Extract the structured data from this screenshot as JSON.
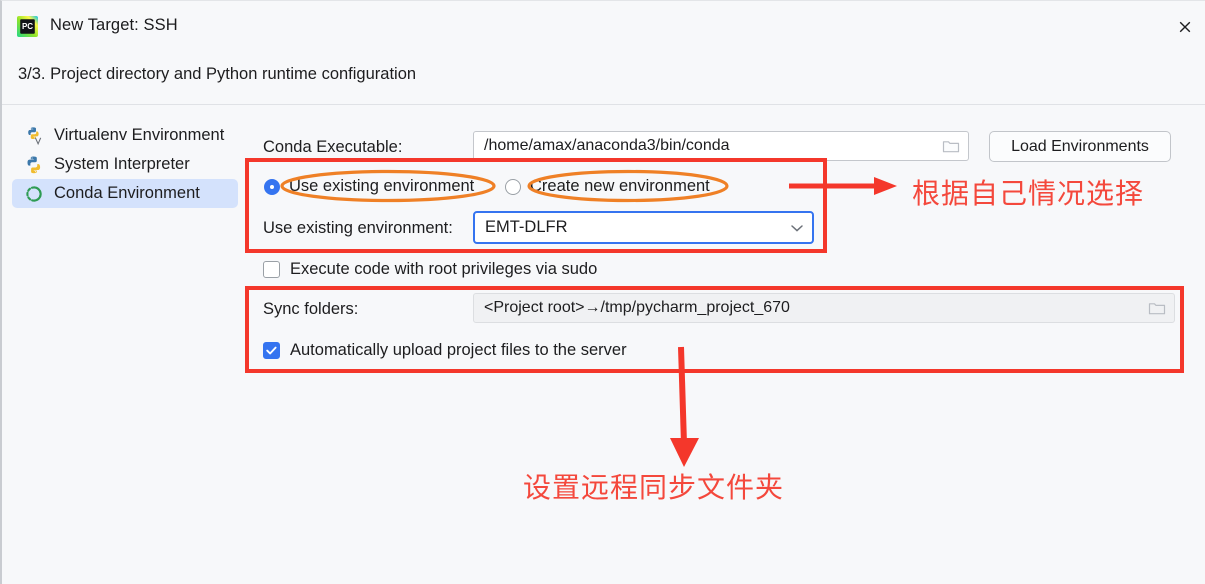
{
  "window": {
    "title": "New Target: SSH",
    "app_icon": "pycharm-icon",
    "close_icon": "close-icon"
  },
  "step": {
    "label": "3/3. Project directory and Python runtime configuration"
  },
  "sidebar": {
    "items": [
      {
        "label": "Virtualenv Environment",
        "icon": "python-virtualenv-icon",
        "selected": false
      },
      {
        "label": "System Interpreter",
        "icon": "python-icon",
        "selected": false
      },
      {
        "label": "Conda Environment",
        "icon": "conda-icon",
        "selected": true
      }
    ]
  },
  "form": {
    "conda_executable_label": "Conda Executable:",
    "conda_executable_value": "/home/amax/anaconda3/bin/conda",
    "conda_executable_placeholder": "Path to conda executable",
    "browse_icon": "folder-icon",
    "load_environments_label": "Load Environments",
    "radio_use_existing": "Use existing environment",
    "radio_create_new": "Create new environment",
    "radio_selected": "use_existing",
    "use_existing_label": "Use existing environment:",
    "environment_value": "EMT-DLFR",
    "environment_dropdown_icon": "chevron-down-icon",
    "sudo_checkbox_label": "Execute code with root privileges via sudo",
    "sudo_checked": false,
    "sync_folders_label": "Sync folders:",
    "sync_folders_value": "<Project root>→/tmp/pycharm_project_670",
    "auto_upload_label": "Automatically upload project files to the server",
    "auto_upload_checked": true
  },
  "annotations": {
    "note_right": "根据自己情况选择",
    "note_bottom": "设置远程同步文件夹",
    "highlight_color": "#f4372b",
    "ellipse_color": "#ef8026",
    "text_color": "#f4483c"
  }
}
